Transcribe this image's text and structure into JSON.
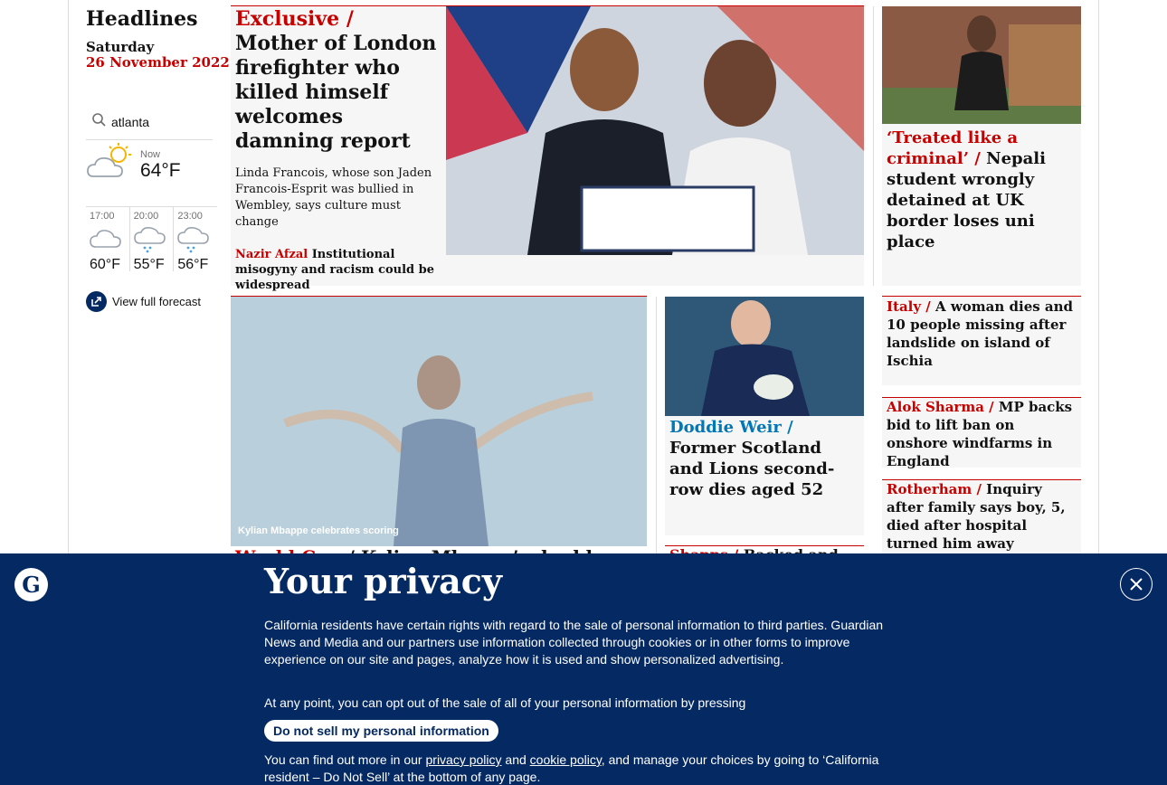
{
  "rail": {
    "title": "Headlines",
    "day": "Saturday",
    "date": "26 November 2022",
    "search_value": "atlanta",
    "now_label": "Now",
    "now_temp": "64°F",
    "forecast": [
      {
        "time": "17:00",
        "temp": "60°F",
        "icon": "cloud-icon"
      },
      {
        "time": "20:00",
        "temp": "55°F",
        "icon": "rain-cloud-icon"
      },
      {
        "time": "23:00",
        "temp": "56°F",
        "icon": "rain-cloud-icon"
      }
    ],
    "full_forecast": "View full forecast"
  },
  "main_story": {
    "kicker": "Exclusive / ",
    "headline": "Mother of London firefighter who killed himself welcomes damning report",
    "standfirst": "Linda Francois, whose son Jaden Francois-Esprit was bullied in Wembley, says culture must change",
    "sub_kicker": "Nazir Afzal",
    "sub_headline": " Institutional misogyny and racism could be widespread"
  },
  "right_story": {
    "kicker": "‘Treated like a criminal’ / ",
    "headline": "Nepali student wrongly detained at UK border loses uni place"
  },
  "mbappe": {
    "caption": "Kylian Mbappe celebrates scoring",
    "kicker": "World Cup ",
    "headline": "/ Kylian Mbappe’s double"
  },
  "doddie": {
    "kicker": "Doddie Weir / ",
    "headline": "Former Scotland and Lions second-row dies aged 52"
  },
  "sharma_small": {
    "kicker": "Shapps / ",
    "headline": "Backed and"
  },
  "side_items": [
    {
      "kicker": "Italy / ",
      "headline": "A woman dies and 10 people missing after landslide on island of Ischia"
    },
    {
      "kicker": "Alok Sharma  / ",
      "headline": "MP backs bid to lift ban on onshore windfarms in England"
    },
    {
      "kicker": "Rotherham / ",
      "headline": "Inquiry after family says boy, 5, died after hospital turned him away"
    }
  ],
  "privacy": {
    "title": "Your privacy",
    "p1": "California residents have certain rights with regard to the sale of personal information to third parties. Guardian News and Media and our partners use information collected through cookies or in other forms to improve experience on our site and pages, analyze how it is used and show personalized advertising.",
    "p2": "At any point, you can opt out of the sale of all of your personal information by pressing",
    "button": "Do not sell my personal information",
    "p3_start": "You can find out more in our ",
    "privacy_link": "privacy policy",
    "and": " and ",
    "cookie_link": "cookie policy",
    "p3_end": ", and manage your choices by going to ‘California resident – Do Not Sell’ at the bottom of any page."
  },
  "colors": {
    "brand": "#052962",
    "kicker": "#c70000",
    "sport": "#0077b6"
  }
}
